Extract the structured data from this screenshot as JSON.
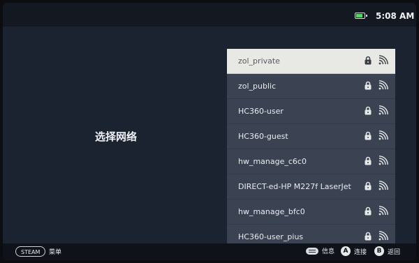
{
  "status": {
    "time": "5:08 AM",
    "battery_icon": "battery-icon"
  },
  "main": {
    "title": "选择网络"
  },
  "networks": [
    {
      "name": "zol_private",
      "secured": true,
      "selected": true
    },
    {
      "name": "zol_public",
      "secured": true,
      "selected": false
    },
    {
      "name": "HC360-user",
      "secured": true,
      "selected": false
    },
    {
      "name": "HC360-guest",
      "secured": true,
      "selected": false
    },
    {
      "name": "hw_manage_c6c0",
      "secured": true,
      "selected": false
    },
    {
      "name": "DIRECT-ed-HP M227f LaserJet",
      "secured": true,
      "selected": false
    },
    {
      "name": "hw_manage_bfc0",
      "secured": true,
      "selected": false
    },
    {
      "name": "HC360-user_pius",
      "secured": true,
      "selected": false
    }
  ],
  "bottombar": {
    "steam_label": "STEAM",
    "menu_label": "菜单",
    "info_label": "信息",
    "connect_button": "A",
    "connect_label": "连接",
    "back_button": "B",
    "back_label": "返回"
  },
  "colors": {
    "selected_bg": "#e8e8e4",
    "list_bg": "#3b4252",
    "screen_bg": "#1b2330"
  }
}
